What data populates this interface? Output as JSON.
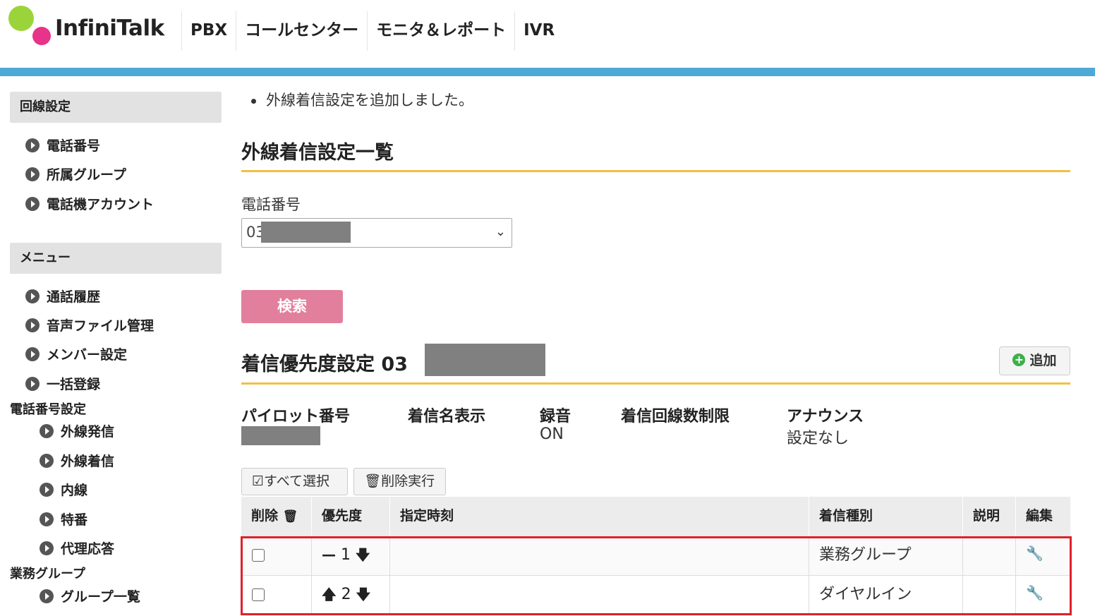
{
  "header": {
    "brand": "InfiniTalk",
    "nav": [
      "PBX",
      "コールセンター",
      "モニタ＆レポート",
      "IVR"
    ]
  },
  "sidebar": {
    "section1": "回線設定",
    "section1_items": [
      "電話番号",
      "所属グループ",
      "電話機アカウント"
    ],
    "section2": "メニュー",
    "section2_items": [
      "通話履歴",
      "音声ファイル管理",
      "メンバー設定",
      "一括登録"
    ],
    "sub1": "電話番号設定",
    "sub1_items": [
      "外線発信",
      "外線着信",
      "内線",
      "特番",
      "代理応答"
    ],
    "sub2": "業務グループ",
    "sub2_items": [
      "グループ一覧"
    ]
  },
  "main": {
    "notice": "外線着信設定を追加しました。",
    "list_title": "外線着信設定一覧",
    "phone_label": "電話番号",
    "phone_value_prefix": "03",
    "search_label": "検索",
    "priority_title": "着信優先度設定 03",
    "add_label": "追加",
    "info": [
      {
        "head": "パイロット番号",
        "value": ""
      },
      {
        "head": "着信名表示",
        "value": ""
      },
      {
        "head": "録音",
        "value": "ON"
      },
      {
        "head": "着信回線数制限",
        "value": ""
      },
      {
        "head": "アナウンス",
        "value": "設定なし"
      }
    ],
    "select_all_label": "すべて選択",
    "delete_exec_label": "削除実行",
    "table": {
      "headers": [
        "削除",
        "優先度",
        "指定時刻",
        "着信種別",
        "説明",
        "編集"
      ],
      "rows": [
        {
          "checked": false,
          "priority": "1",
          "time": "",
          "type": "業務グループ",
          "desc": "",
          "up": false,
          "down": true
        },
        {
          "checked": false,
          "priority": "2",
          "time": "",
          "type": "ダイヤルイン",
          "desc": "",
          "up": true,
          "down": true
        }
      ]
    }
  },
  "colors": {
    "accent_blue": "#4fa9d6",
    "gold_rule": "#f2c040",
    "search_pink": "#e27f9c",
    "highlight_red": "#e0202a",
    "logo_green": "#9bd43a",
    "logo_pink": "#e8338a"
  },
  "icons": [
    "logo-icon",
    "bullet-arrow-icon",
    "add-plus-icon",
    "check-icon",
    "trash-icon",
    "arrow-up-icon",
    "arrow-down-icon",
    "minus-icon",
    "wrench-icon",
    "chevron-down-icon"
  ]
}
